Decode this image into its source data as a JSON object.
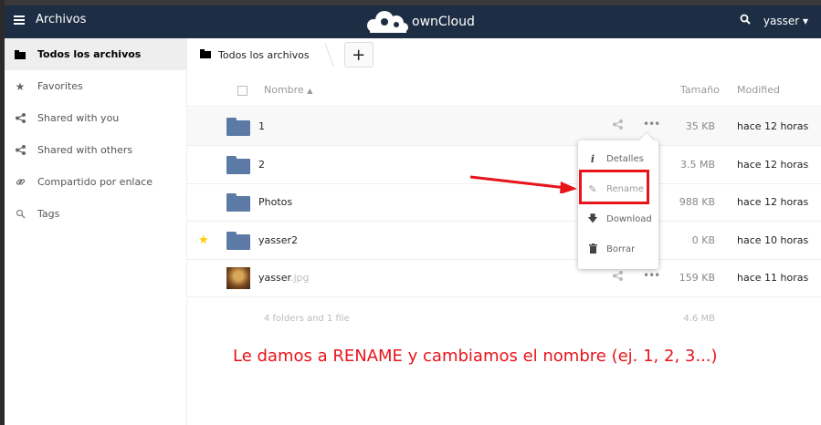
{
  "topbar": {
    "menu_label": "Archivos",
    "logo_text": "ownCloud",
    "user": "yasser",
    "caret": "▾"
  },
  "sidebar": {
    "items": [
      {
        "label": "Todos los archivos",
        "icon": "folder-icon"
      },
      {
        "label": "Favorites",
        "icon": "star-icon"
      },
      {
        "label": "Shared with you",
        "icon": "share-icon"
      },
      {
        "label": "Shared with others",
        "icon": "share-icon"
      },
      {
        "label": "Compartido por enlace",
        "icon": "link-icon"
      },
      {
        "label": "Tags",
        "icon": "tag-icon"
      }
    ]
  },
  "breadcrumb": {
    "label": "Todos los archivos",
    "add": "+"
  },
  "table": {
    "col_name": "Nombre",
    "col_size": "Tamaño",
    "col_modified": "Modified",
    "rows": [
      {
        "name": "1",
        "ext": "",
        "size": "35 KB",
        "modified": "hace 12 horas"
      },
      {
        "name": "2",
        "ext": "",
        "size": "3.5 MB",
        "modified": "hace 12 horas"
      },
      {
        "name": "Photos",
        "ext": "",
        "size": "988 KB",
        "modified": "hace 12 horas"
      },
      {
        "name": "yasser2",
        "ext": "",
        "size": "0 KB",
        "modified": "hace 10 horas"
      },
      {
        "name": "yasser",
        "ext": ".jpg",
        "size": "159 KB",
        "modified": "hace 11 horas"
      }
    ],
    "summary_count": "4 folders and 1 file",
    "summary_size": "4.6 MB"
  },
  "popup": {
    "items": [
      {
        "label": "Detalles",
        "icon": "info-icon"
      },
      {
        "label": "Rename",
        "icon": "pencil-icon"
      },
      {
        "label": "Download",
        "icon": "download-icon"
      },
      {
        "label": "Borrar",
        "icon": "trash-icon"
      }
    ]
  },
  "annotation": "Le damos a RENAME y cambiamos el nombre (ej. 1, 2, 3...)",
  "colors": {
    "header": "#1d2d44",
    "folder": "#5b7aa6",
    "annotation": "#e8141a",
    "favorite": "#ffcc00"
  }
}
